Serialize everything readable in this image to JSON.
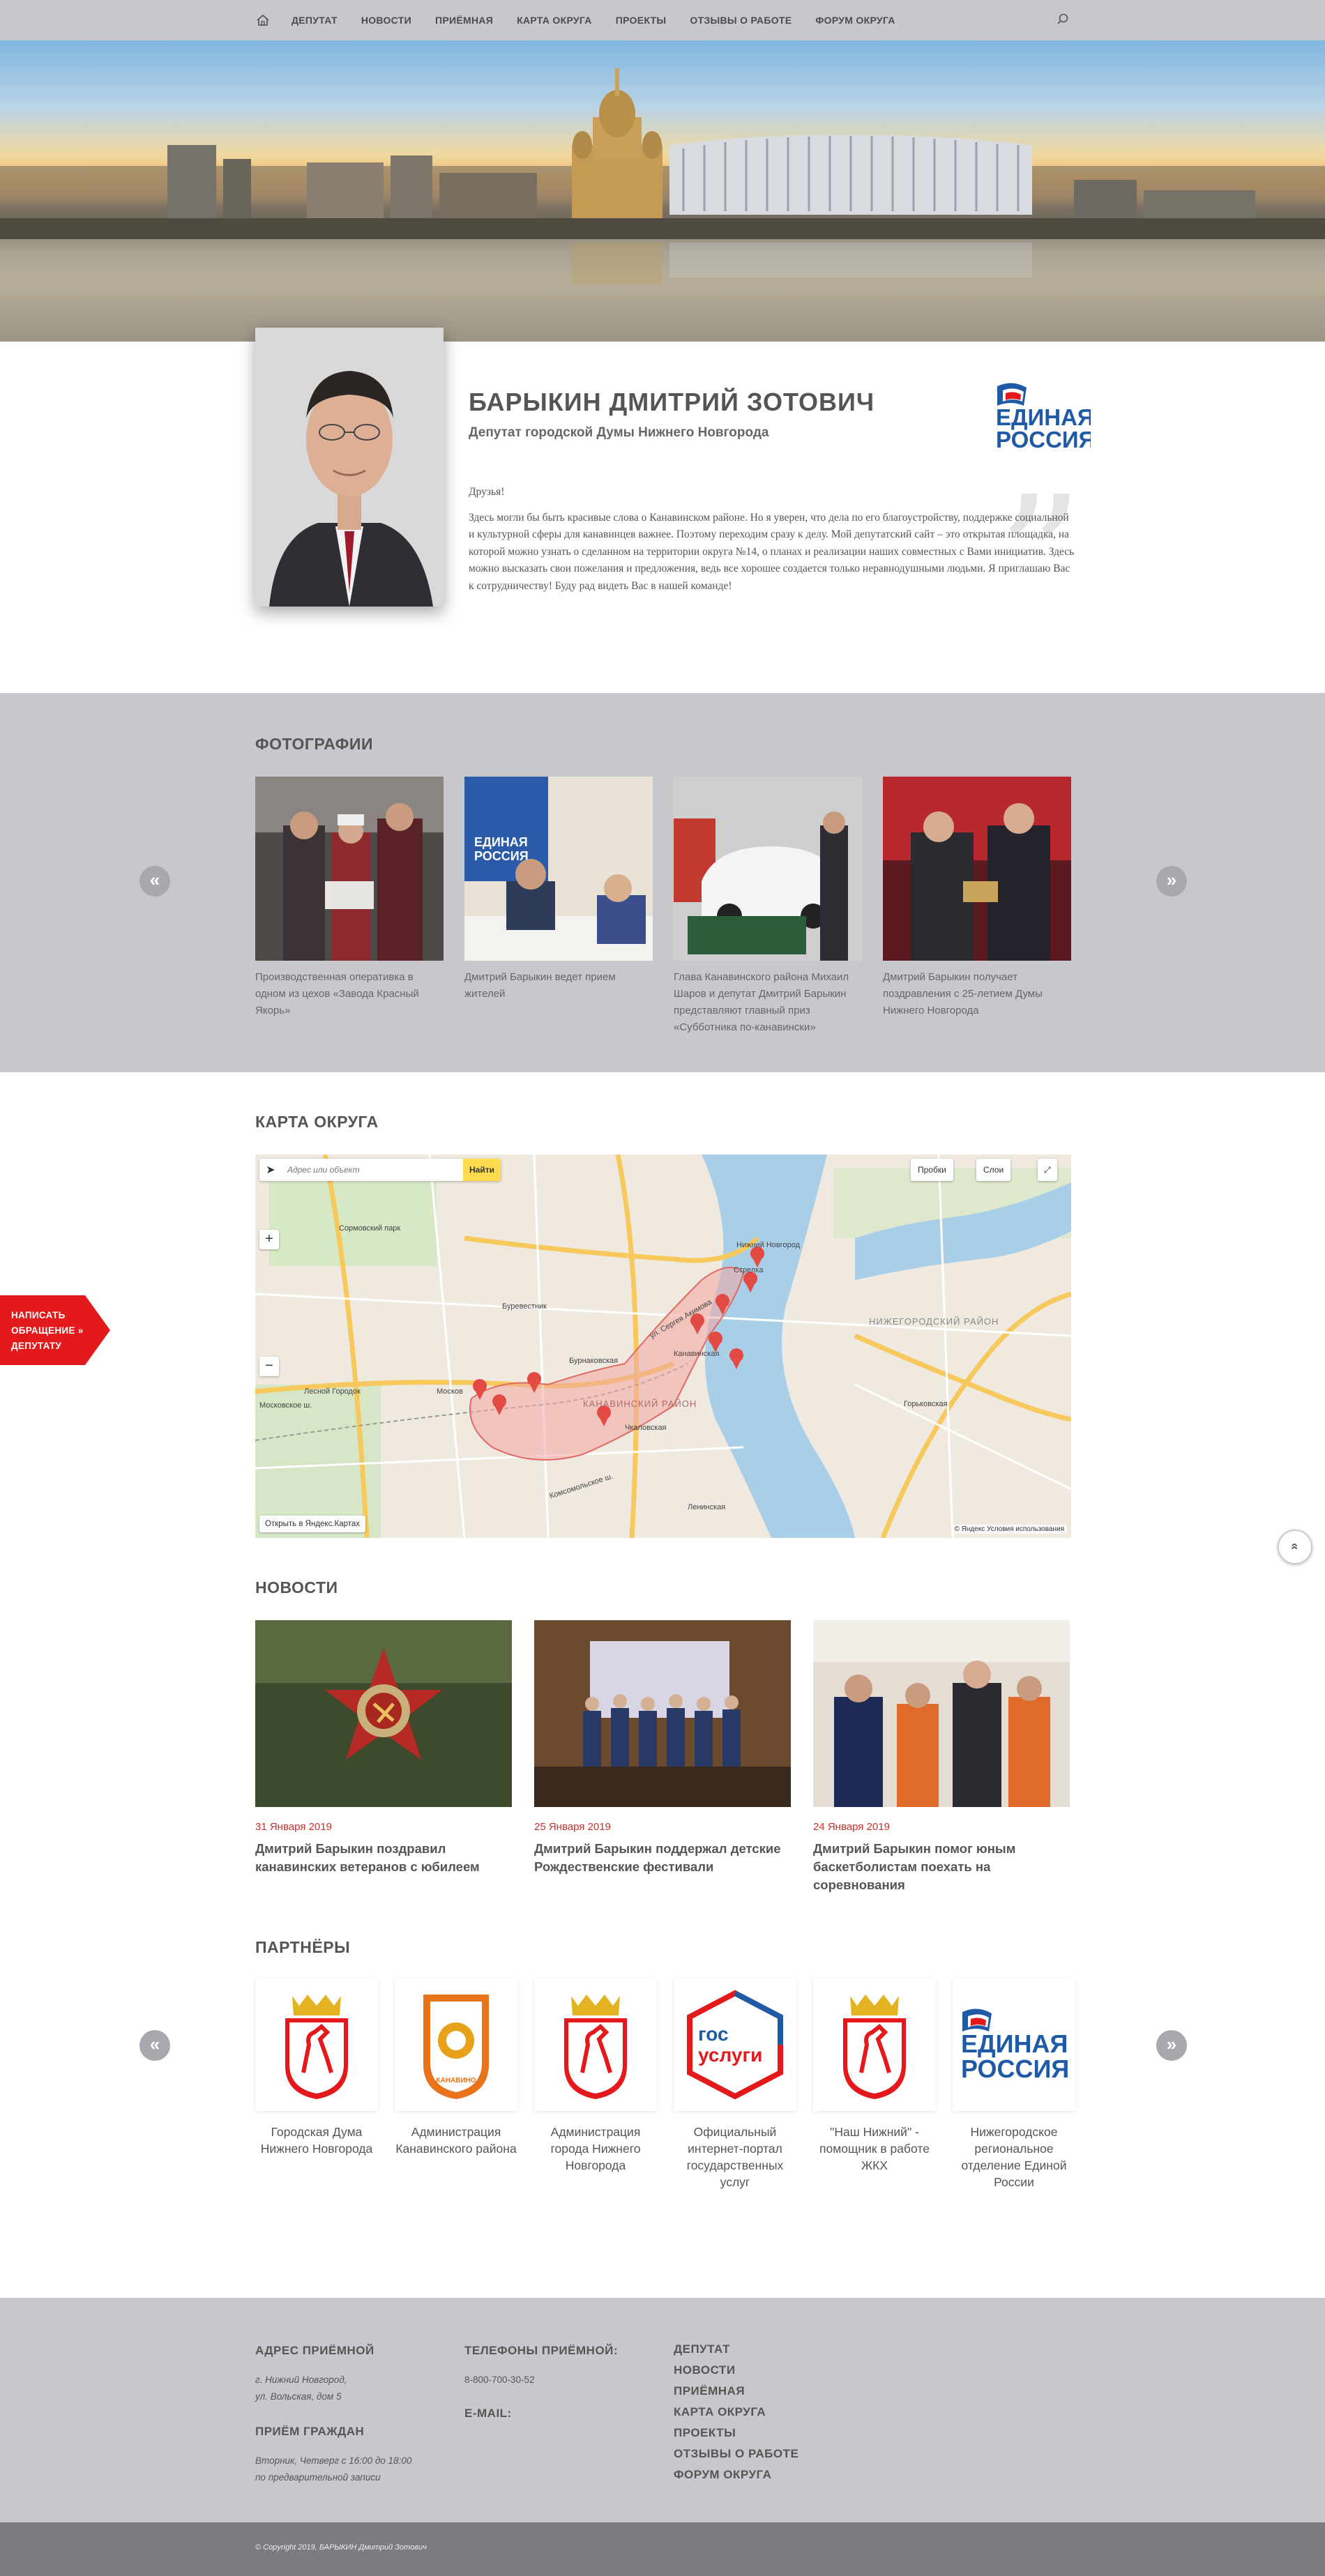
{
  "nav": {
    "items": [
      "ДЕПУТАТ",
      "НОВОСТИ",
      "ПРИЁМНАЯ",
      "КАРТА ОКРУГА",
      "ПРОЕКТЫ",
      "ОТЗЫВЫ О РАБОТЕ",
      "ФОРУМ ОКРУГА"
    ]
  },
  "profile": {
    "name": "БАРЫКИН ДМИТРИЙ ЗОТОВИЧ",
    "subtitle": "Депутат городской Думы Нижнего Новгорода",
    "greeting": "Друзья!",
    "text": "Здесь могли бы быть красивые слова о Канавинском районе. Но я уверен, что дела по его благоустройству, поддержке социальной и культурной сферы для канавинцев важнее. Поэтому переходим сразу к делу. Мой депутатский сайт – это открытая площадка, на которой можно узнать о сделанном на территории округа №14, о планах и реализации наших совместных с Вами инициатив. Здесь можно высказать свои пожелания и предложения, ведь все хорошее создается только неравнодушными людьми. Я приглашаю Вас к сотрудничеству! Буду рад видеть Вас в нашей команде!",
    "party_logo": {
      "line1": "ЕДИНАЯ",
      "line2": "РОССИЯ"
    }
  },
  "photos": {
    "title": "ФОТОГРАФИИ",
    "prev": "«",
    "next": "»",
    "items": [
      {
        "caption": "Производственная оперативка в одном из цехов «Завода Красный Якорь»"
      },
      {
        "caption": "Дмитрий Барыкин ведет прием жителей"
      },
      {
        "caption": "Глава Канавинского района Михаил Шаров и депутат Дмитрий Барыкин представляют главный приз «Субботника по-канавински»"
      },
      {
        "caption": "Дмитрий Барыкин получает поздравления с 25-летием Думы Нижнего Новгорода"
      }
    ]
  },
  "map": {
    "title": "КАРТА ОКРУГА",
    "search_placeholder": "Адрес или объект",
    "search_button": "Найти",
    "traffic": "Пробки",
    "layers": "Слои",
    "open_link": "Открыть в Яндекс.Картах",
    "copyright": "© Яндекс  Условия использования",
    "labels": {
      "district": "КАНАВИНСКИЙ РАЙОН",
      "nizhegorodsky": "НИЖЕГОРОДСКИЙ РАЙОН",
      "moskovskoe": "Московское ш.",
      "burevestnik": "Буревестник",
      "burnakovskaya": "Бурнаковская",
      "kanavinskaya": "Канавинская",
      "gorkovskaya": "Горьковская",
      "strelka": "Стрелка",
      "nizhny": "Нижний Новгород",
      "sormovsky": "Сормовский парк",
      "sergey": "ул. Сергея Акимова",
      "chkalovskaya": "Чкаловская",
      "lesnoy": "Лесной Городок",
      "moscow": "Москов",
      "leninskaya": "Ленинская",
      "komsomolskoe": "Комсомольское ш."
    }
  },
  "side_tab": {
    "line1": "НАПИСАТЬ",
    "line2": "ОБРАЩЕНИЕ »",
    "line3": "ДЕПУТАТУ"
  },
  "scroll_top": "«",
  "news": {
    "title": "НОВОСТИ",
    "items": [
      {
        "date": "31 Января 2019",
        "title": "Дмитрий Барыкин поздравил канавинских ветеранов с юбилеем"
      },
      {
        "date": "25 Января 2019",
        "title": "Дмитрий Барыкин поддержал детские Рождественские фестивали"
      },
      {
        "date": "24 Января 2019",
        "title": "Дмитрий Барыкин помог юным баскетболистам поехать на соревнования"
      }
    ]
  },
  "partners": {
    "title": "ПАРТНЁРЫ",
    "prev": "«",
    "next": "»",
    "items": [
      {
        "name": "Городская Дума Нижнего Новгорода"
      },
      {
        "name": "Администрация Канавинского района"
      },
      {
        "name": "Администрация города Нижнего Новгорода"
      },
      {
        "name": "Официальный интернет-портал государственных услуг"
      },
      {
        "name": "\"Наш Нижний\" - помощник в работе ЖКХ"
      },
      {
        "name": "Нижегородское региональное отделение Единой России"
      }
    ],
    "gosuslugi": {
      "line1": "гос",
      "line2": "услуги"
    },
    "kanavino_label": "КАНАВИНО"
  },
  "footer": {
    "address_title": "АДРЕС ПРИЁМНОЙ",
    "address_line1": "г. Нижний Новгород,",
    "address_line2": "ул. Вольская, дом 5",
    "reception_title": "ПРИЁМ ГРАЖДАН",
    "reception_line1": "Вторник, Четверг с 16:00 до 18:00",
    "reception_line2": "по предварительной записи",
    "phones_title": "ТЕЛЕФОНЫ ПРИЁМНОЙ:",
    "phone": "8-800-700-30-52",
    "email_title": "E-MAIL:",
    "links": [
      "ДЕПУТАТ",
      "НОВОСТИ",
      "ПРИЁМНАЯ",
      "КАРТА ОКРУГА",
      "ПРОЕКТЫ",
      "ОТЗЫВЫ О РАБОТЕ",
      "ФОРУМ ОКРУГА"
    ],
    "copyright": "© Copyright 2019, БАРЫКИН Дмитрий Зотович"
  },
  "colors": {
    "accent_red": "#e3191b",
    "nav_bg": "#c8c8cc",
    "date_red": "#c9302c"
  }
}
